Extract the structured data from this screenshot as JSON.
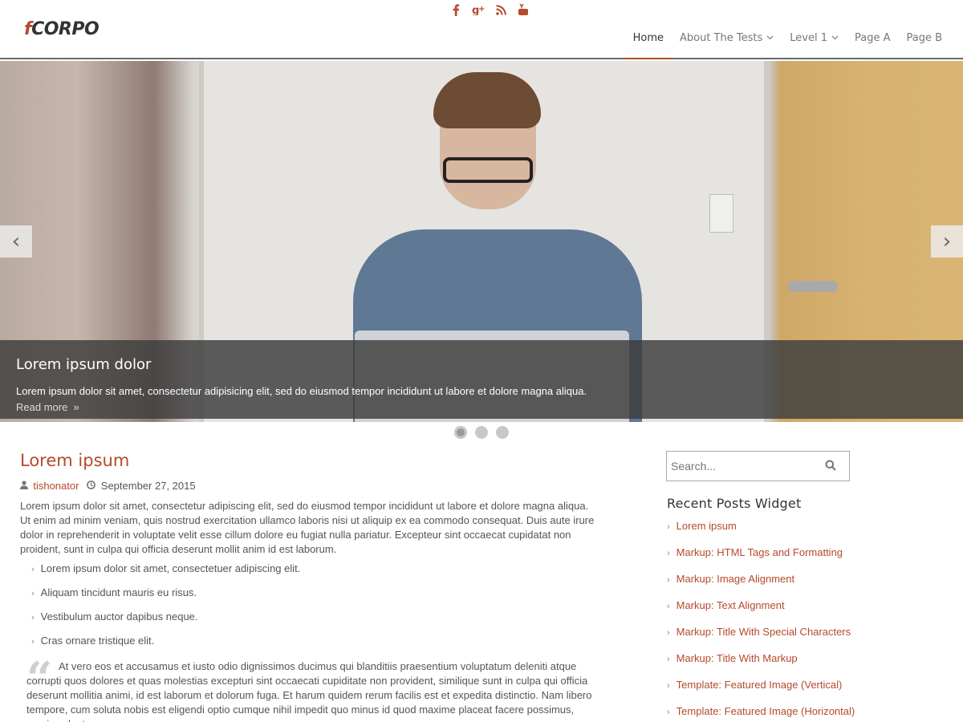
{
  "brand": {
    "prefix": "f",
    "name": "CORPO",
    "accent": "#b5492c"
  },
  "social": [
    {
      "name": "facebook-icon",
      "glyph": "f"
    },
    {
      "name": "google-plus-icon",
      "glyph": "g+"
    },
    {
      "name": "rss-icon",
      "glyph": "rss"
    },
    {
      "name": "youtube-icon",
      "glyph": "You"
    }
  ],
  "nav": {
    "items": [
      {
        "label": "Home",
        "active": true,
        "dropdown": false
      },
      {
        "label": "About The Tests",
        "active": false,
        "dropdown": true
      },
      {
        "label": "Level 1",
        "active": false,
        "dropdown": true
      },
      {
        "label": "Page A",
        "active": false,
        "dropdown": false
      },
      {
        "label": "Page B",
        "active": false,
        "dropdown": false
      }
    ]
  },
  "slider": {
    "title": "Lorem ipsum dolor",
    "text": "Lorem ipsum dolor sit amet, consectetur adipisicing elit, sed do eiusmod tempor incididunt ut labore et dolore magna aliqua.",
    "read_more": "Read more",
    "prev": "‹",
    "next": "›",
    "slide_count": 3,
    "active_slide": 1
  },
  "post": {
    "title": "Lorem ipsum",
    "author": "tishonator",
    "date": "September 27, 2015",
    "body": "Lorem ipsum dolor sit amet, consectetur adipiscing elit, sed do eiusmod tempor incididunt ut labore et dolore magna aliqua. Ut enim ad minim veniam, quis nostrud exercitation ullamco laboris nisi ut aliquip ex ea commodo consequat. Duis aute irure dolor in reprehenderit in voluptate velit esse cillum dolore eu fugiat nulla pariatur. Excepteur sint occaecat cupidatat non proident, sunt in culpa qui officia deserunt mollit anim id est laborum.",
    "list": [
      "Lorem ipsum dolor sit amet, consectetuer adipiscing elit.",
      "Aliquam tincidunt mauris eu risus.",
      "Vestibulum auctor dapibus neque.",
      "Cras ornare tristique elit."
    ],
    "quote": "At vero eos et accusamus et iusto odio dignissimos ducimus qui blanditiis praesentium voluptatum deleniti atque corrupti quos dolores et quas molestias excepturi sint occaecati cupiditate non provident, similique sunt in culpa qui officia deserunt mollitia animi, id est laborum et dolorum fuga. Et harum quidem rerum facilis est et expedita distinctio. Nam libero tempore, cum soluta nobis est eligendi optio cumque nihil impedit quo minus id quod maxime placeat facere possimus, omnis voluptas"
  },
  "sidebar": {
    "search_placeholder": "Search...",
    "widget_title": "Recent Posts Widget",
    "recent_posts": [
      "Lorem ipsum",
      "Markup: HTML Tags and Formatting",
      "Markup: Image Alignment",
      "Markup: Text Alignment",
      "Markup: Title With Special Characters",
      "Markup: Title With Markup",
      "Template: Featured Image (Vertical)",
      "Template: Featured Image (Horizontal)"
    ]
  }
}
